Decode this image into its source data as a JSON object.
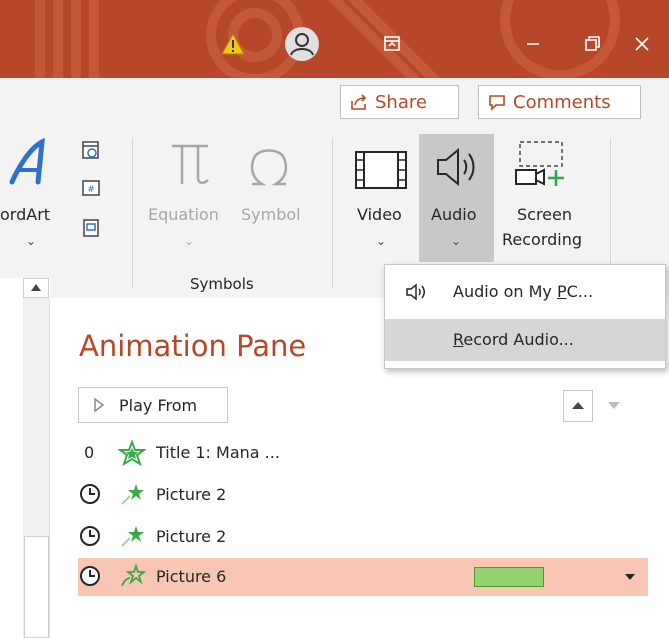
{
  "titlebar": {
    "icons": [
      "warning-icon",
      "user-avatar-icon",
      "ribbon-display-options-icon",
      "minimize-icon",
      "restore-icon",
      "close-icon"
    ],
    "accent_color": "#b7472a"
  },
  "share": {
    "share_label": "Share",
    "comments_label": "Comments"
  },
  "ribbon": {
    "wordart_label": "ordArt",
    "equation_label": "Equation",
    "symbol_label": "Symbol",
    "symbols_group_label": "Symbols",
    "video_label": "Video",
    "audio_label": "Audio",
    "screen_recording_line1": "Screen",
    "screen_recording_line2": "Recording"
  },
  "audio_menu": {
    "items": [
      {
        "pre": "Audio on My ",
        "accel": "P",
        "post": "C...",
        "icon": "speaker-icon"
      },
      {
        "pre": "",
        "accel": "R",
        "post": "ecord Audio...",
        "icon": ""
      }
    ],
    "highlighted_index": 1
  },
  "animation_pane": {
    "title": "Animation Pane",
    "play_from_label": "Play From",
    "items": [
      {
        "number": "0",
        "label": "Title 1: Mana ...",
        "trigger": "on-click",
        "effect": "entrance-star-icon"
      },
      {
        "number": "",
        "label": "Picture 2",
        "trigger": "clock-icon",
        "effect": "emphasis-star-icon"
      },
      {
        "number": "",
        "label": "Picture 2",
        "trigger": "clock-icon",
        "effect": "emphasis-star-icon"
      },
      {
        "number": "",
        "label": "Picture 6",
        "trigger": "clock-icon",
        "effect": "motion-star-icon",
        "selected": true
      }
    ],
    "selected_color": "#f8c7b3",
    "timing_bar_color": "#92d36e"
  }
}
